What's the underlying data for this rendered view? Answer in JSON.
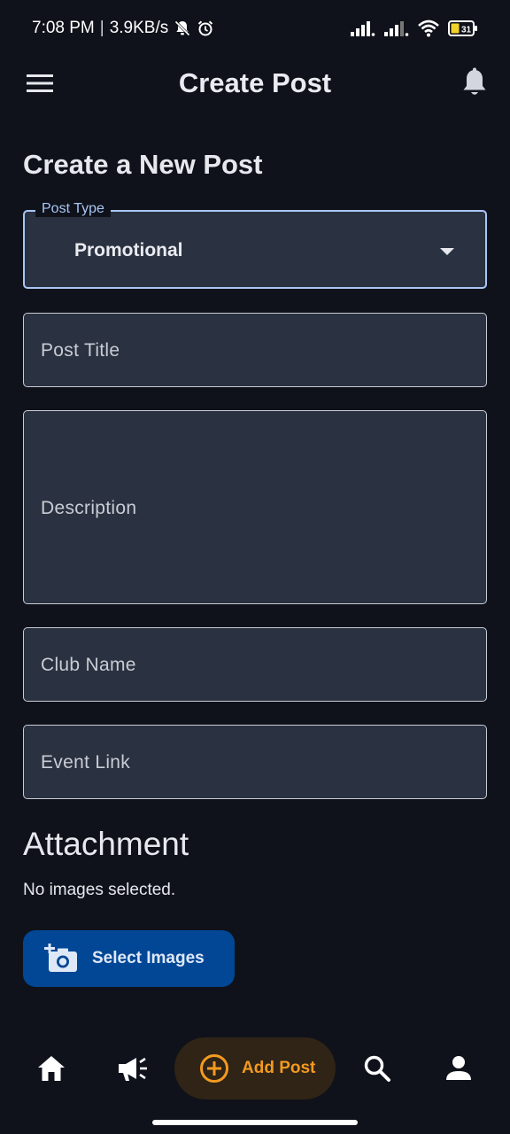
{
  "status_bar": {
    "time": "7:08 PM",
    "separator": "|",
    "speed": "3.9KB/s",
    "battery_level": "31"
  },
  "app_bar": {
    "title": "Create Post",
    "menu_icon": "hamburger-menu-icon",
    "bell_icon": "bell-icon"
  },
  "form": {
    "heading": "Create a New Post",
    "post_type": {
      "label": "Post Type",
      "value": "Promotional"
    },
    "post_title": {
      "placeholder": "Post Title"
    },
    "description": {
      "placeholder": "Description"
    },
    "club_name": {
      "placeholder": "Club Name"
    },
    "event_link": {
      "placeholder": "Event Link"
    }
  },
  "attachment": {
    "heading": "Attachment",
    "status": "No images selected.",
    "button_label": "Select Images",
    "button_icon": "add-photo-icon"
  },
  "bottom_nav": {
    "home_icon": "home-icon",
    "announce_icon": "megaphone-icon",
    "add_label": "Add Post",
    "add_icon": "add-circle-icon",
    "search_icon": "search-icon",
    "profile_icon": "profile-icon"
  },
  "colors": {
    "background": "#0f121a",
    "field_background": "#2a3140",
    "focus_border": "#a9c6f5",
    "primary_button": "#014795",
    "accent_orange": "#f39a21"
  }
}
